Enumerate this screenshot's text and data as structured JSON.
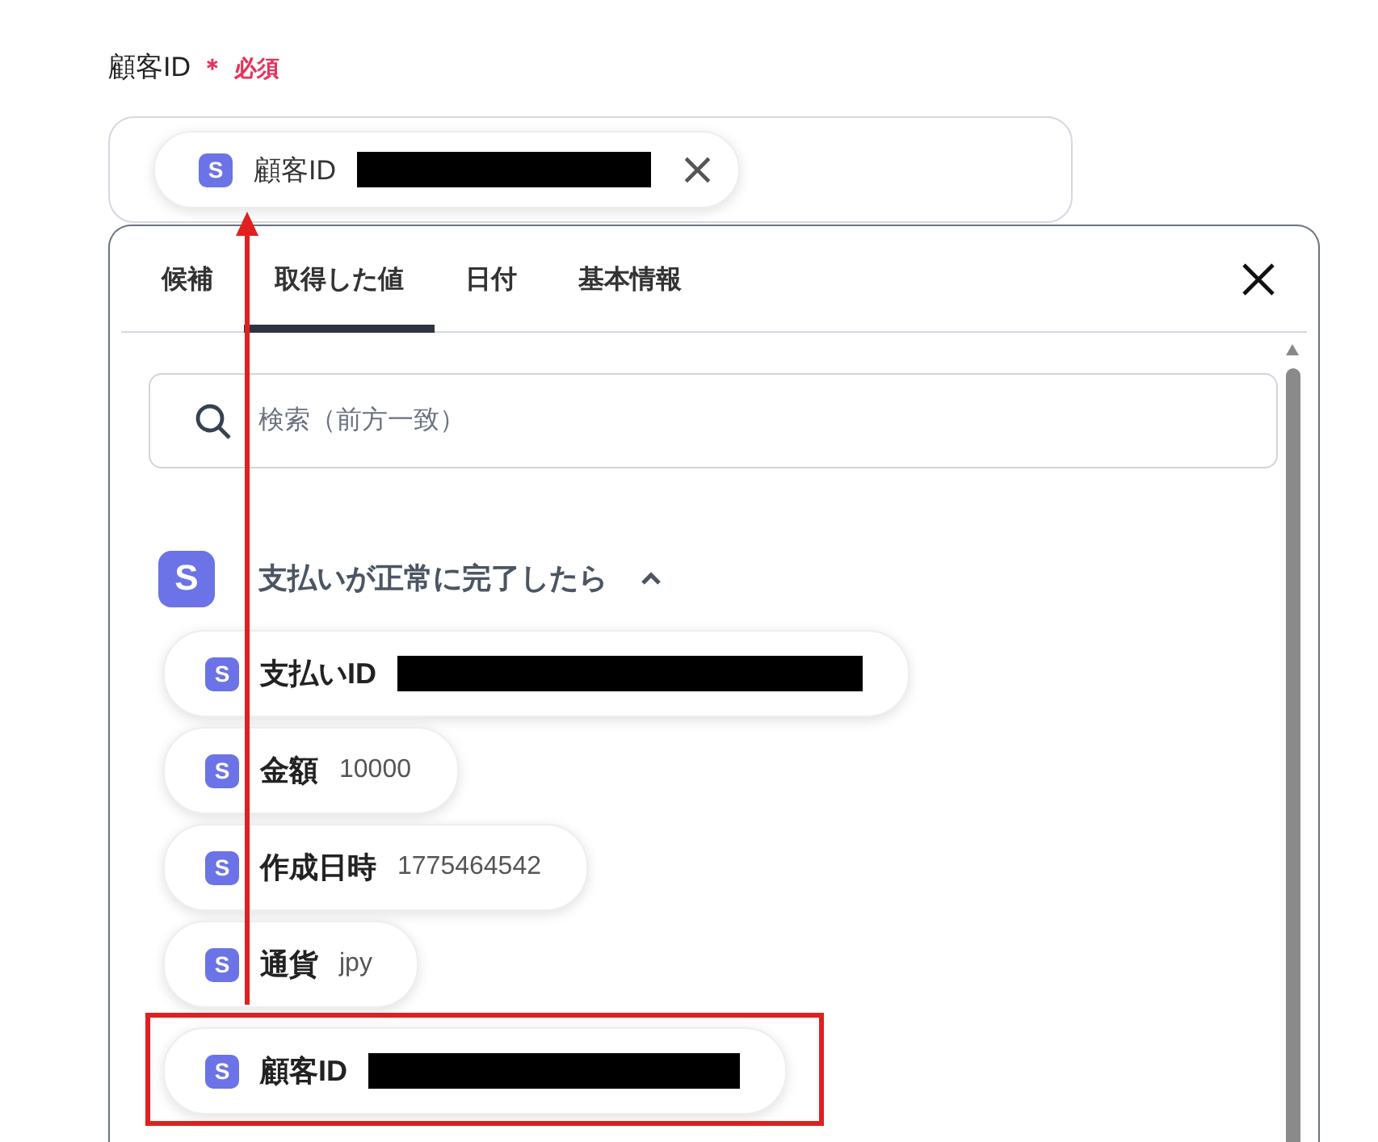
{
  "field": {
    "label": "顧客ID",
    "required_mark": "＊",
    "required_text": "必須",
    "chip": {
      "icon": "S",
      "name": "顧客ID",
      "value_redacted": true,
      "remove": "×"
    }
  },
  "panel": {
    "tabs": [
      {
        "label": "候補",
        "selected": false
      },
      {
        "label": "取得した値",
        "selected": true
      },
      {
        "label": "日付",
        "selected": false
      },
      {
        "label": "基本情報",
        "selected": false
      }
    ],
    "search": {
      "placeholder": "検索（前方一致）"
    },
    "group": {
      "icon": "S",
      "title": "支払いが正常に完了したら",
      "expanded": true,
      "items": [
        {
          "icon": "S",
          "name": "支払いID",
          "value_redacted": true,
          "highlighted": false
        },
        {
          "icon": "S",
          "name": "金額",
          "value": "10000",
          "highlighted": false
        },
        {
          "icon": "S",
          "name": "作成日時",
          "value": "1775464542",
          "highlighted": false
        },
        {
          "icon": "S",
          "name": "通貨",
          "value": "jpy",
          "highlighted": false
        },
        {
          "icon": "S",
          "name": "顧客ID",
          "value_redacted": true,
          "highlighted": true
        }
      ]
    }
  }
}
